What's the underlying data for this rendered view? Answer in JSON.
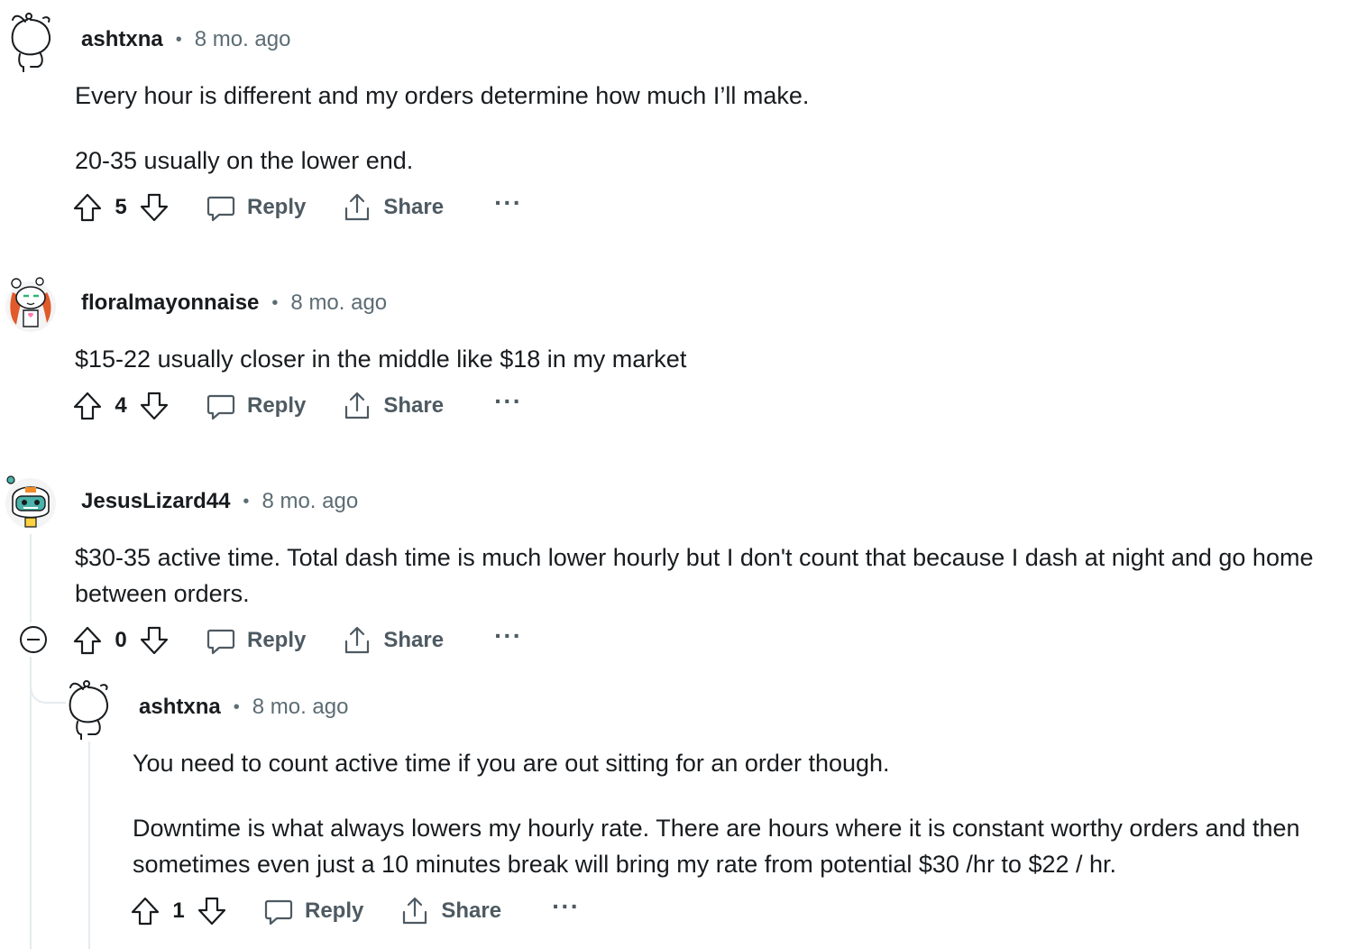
{
  "comments": [
    {
      "author": "ashtxna",
      "time": "8 mo. ago",
      "paragraphs": [
        "Every hour is different and my orders determine how much I’ll make.",
        "20-35 usually on the lower end."
      ],
      "score": "5",
      "reply_label": "Reply",
      "share_label": "Share",
      "more_label": "···",
      "avatar": "snoo-default-icon"
    },
    {
      "author": "floralmayonnaise",
      "time": "8 mo. ago",
      "paragraphs": [
        "$15-22 usually closer in the middle like $18 in my market"
      ],
      "score": "4",
      "reply_label": "Reply",
      "share_label": "Share",
      "more_label": "···",
      "avatar": "snoo-orange-hair-icon"
    },
    {
      "author": "JesusLizard44",
      "time": "8 mo. ago",
      "paragraphs": [
        "$30-35 active time. Total dash time is much lower hourly but I don't count that because I dash at night and go home between orders."
      ],
      "score": "0",
      "reply_label": "Reply",
      "share_label": "Share",
      "more_label": "···",
      "avatar": "snoo-robot-helmet-icon"
    },
    {
      "author": "ashtxna",
      "time": "8 mo. ago",
      "paragraphs": [
        "You need to count active time if you are out sitting for an order though.",
        "Downtime is what always lowers my hourly rate. There are hours where it is constant worthy orders and then sometimes even just a 10 minutes break will bring my rate from potential $30 /hr to $22 / hr."
      ],
      "score": "1",
      "reply_label": "Reply",
      "share_label": "Share",
      "more_label": "···",
      "avatar": "snoo-default-icon"
    }
  ],
  "colors": {
    "text": "#181c1f",
    "meta": "#5c6c74",
    "action": "#4e5a62",
    "thread": "#e5ebee"
  }
}
